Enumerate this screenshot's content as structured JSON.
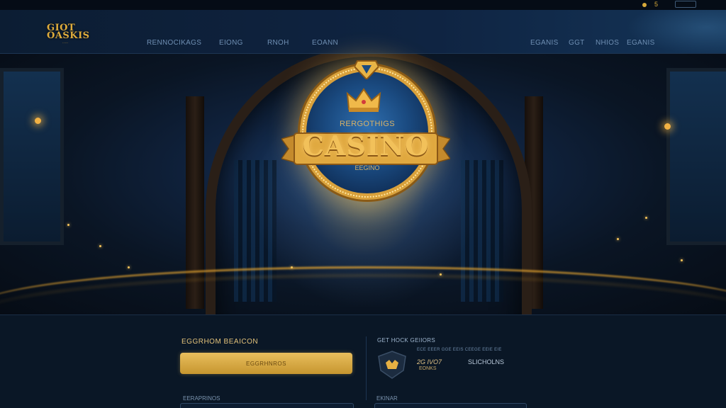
{
  "topbar": {
    "count": "5"
  },
  "nav": {
    "logo_line1": "GIOT",
    "logo_line2": "OASKIS",
    "left_links": [
      "RENNOCIKAGS",
      "EIONG",
      "RNOH",
      "EOANN"
    ],
    "right_links": [
      "EGANIS",
      "GGT",
      "NHIOS",
      "EGANIS"
    ]
  },
  "hero": {
    "badge_top": "RERGOTHIGS",
    "badge_title": "CASINO",
    "badge_sub": "EEGINO"
  },
  "form": {
    "title": "EGGRHOM BEAICON",
    "cta_label": "EGGRHNROS",
    "field1_label": "EERAPRINOS",
    "field2_label": "EKINAR"
  },
  "side": {
    "title": "GET HOCK GEIIORS",
    "subtitle": "ECE EEER GGE EEIS CEEGE EEIE EIE",
    "stat_value": "2G IVO7",
    "stat_caption": "EONKS",
    "stat_label": "SLICHOLNS"
  },
  "colors": {
    "accent_gold": "#e0ad3c",
    "navy_bg": "#0a1726",
    "badge_blue": "#1a4a80"
  }
}
